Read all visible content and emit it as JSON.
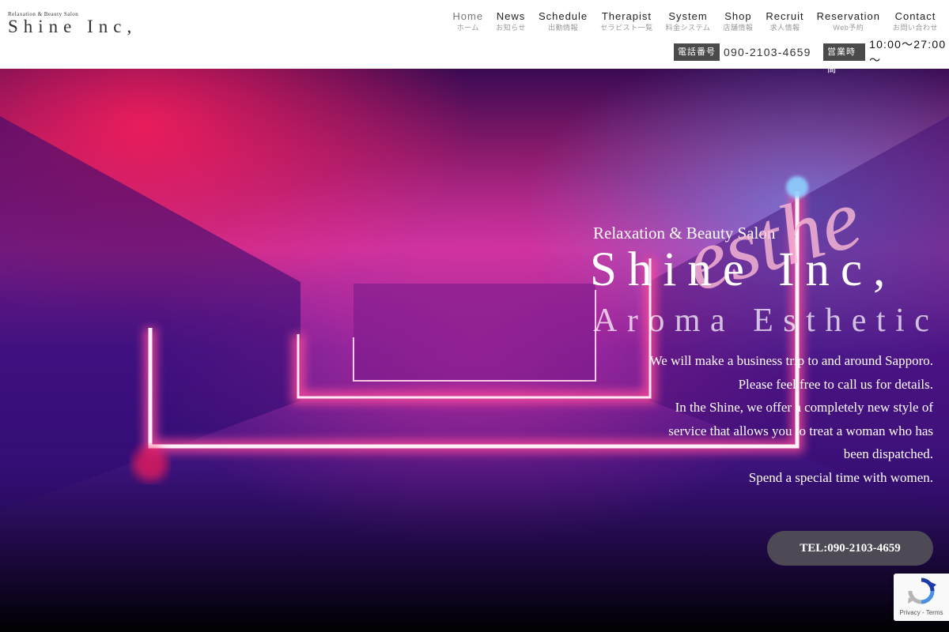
{
  "header": {
    "logo_small": "Relaxation & Beauty Salon",
    "logo_main": "Shine Inc,",
    "nav": [
      {
        "en": "Home",
        "jp": "ホーム",
        "active": true
      },
      {
        "en": "News",
        "jp": "お知らせ"
      },
      {
        "en": "Schedule",
        "jp": "出勤情報"
      },
      {
        "en": "Therapist",
        "jp": "セラピスト一覧"
      },
      {
        "en": "System",
        "jp": "料金システム"
      },
      {
        "en": "Shop",
        "jp": "店舗情報"
      },
      {
        "en": "Recruit",
        "jp": "求人情報"
      },
      {
        "en": "Reservation",
        "jp": "Web予約"
      },
      {
        "en": "Contact",
        "jp": "お問い合わせ"
      }
    ],
    "tel_label": "電話番号",
    "tel_value": "090-2103-4659",
    "hours_label": "営業時間",
    "hours_value": "10:00～27:00～"
  },
  "hero": {
    "subtitle": "Relaxation & Beauty Salon",
    "title": "Shine Inc,",
    "script": "esthe",
    "aroma": "Aroma Esthetic",
    "description": [
      "We will make a business trip to and around Sapporo.",
      "Please feel free to call us for details.",
      "In the Shine, we offer a completely new style of",
      "service that allows you to treat a woman who has",
      "been dispatched.",
      "Spend a special time with women."
    ],
    "tel_button": "TEL:090-2103-4659"
  },
  "recaptcha": {
    "links": "Privacy - Terms"
  },
  "colors": {
    "hero_pink": "#ff2a7a",
    "hero_violet": "#4b0f8a",
    "button": "#4d4a55"
  }
}
